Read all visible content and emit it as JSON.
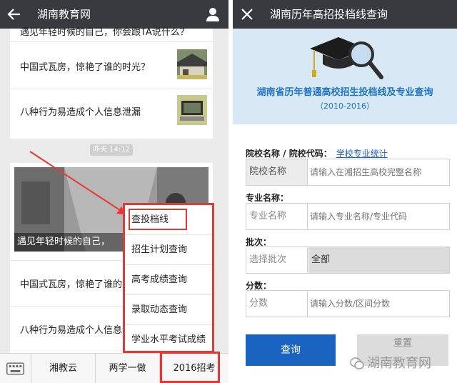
{
  "left_screen": {
    "header": {
      "title": "湖南教育网"
    },
    "top_clipped_text": "遇见年轻时候的自己，你会跟TA说什么？",
    "articles_top": [
      {
        "title": "中国式瓦房，惊艳了谁的时光？"
      },
      {
        "title": "八种行为易造成个人信息泄漏"
      }
    ],
    "timestamp": "昨天 14:12",
    "hero_caption": "遇见年轻时候的自己，",
    "articles_bottom": [
      {
        "title": "中国式瓦房，惊艳了谁的时光？"
      },
      {
        "title": "八种行为易造成个人信息泄漏"
      }
    ],
    "popup_menu": [
      "查投档线",
      "招生计划查询",
      "高考成绩查询",
      "录取动态查询",
      "学业水平考试成绩"
    ],
    "bottom_tabs": [
      "湘教云",
      "两学一做",
      "2016招考"
    ],
    "colors": {
      "topbar": "#393a3f",
      "highlight": "#e53935"
    }
  },
  "right_screen": {
    "header": {
      "title": "湖南历年高招投档线查询"
    },
    "banner": {
      "title": "湖南省历年普通高校招生投档线及专业查询",
      "subtitle": "（2010-2016）"
    },
    "fields": [
      {
        "label": "院校名称 / 院校代码：",
        "link": "学校专业统计",
        "box_label": "院校名称",
        "placeholder": "请输入在湘招生高校完整名称"
      },
      {
        "label": "专业名称：",
        "box_label": "专业名称",
        "placeholder": "请输入专业名称/专业代码"
      },
      {
        "label": "批次：",
        "box_label": "选择批次",
        "selected": "全部"
      },
      {
        "label": "分数：",
        "box_label": "分数",
        "placeholder": "请输入分数/区间分数"
      }
    ],
    "buttons": {
      "query": "查询",
      "reset": "重置"
    },
    "watermark": "湖南教育网",
    "colors": {
      "primary": "#1a62c0",
      "banner_bg": "#d9e8f5"
    }
  }
}
